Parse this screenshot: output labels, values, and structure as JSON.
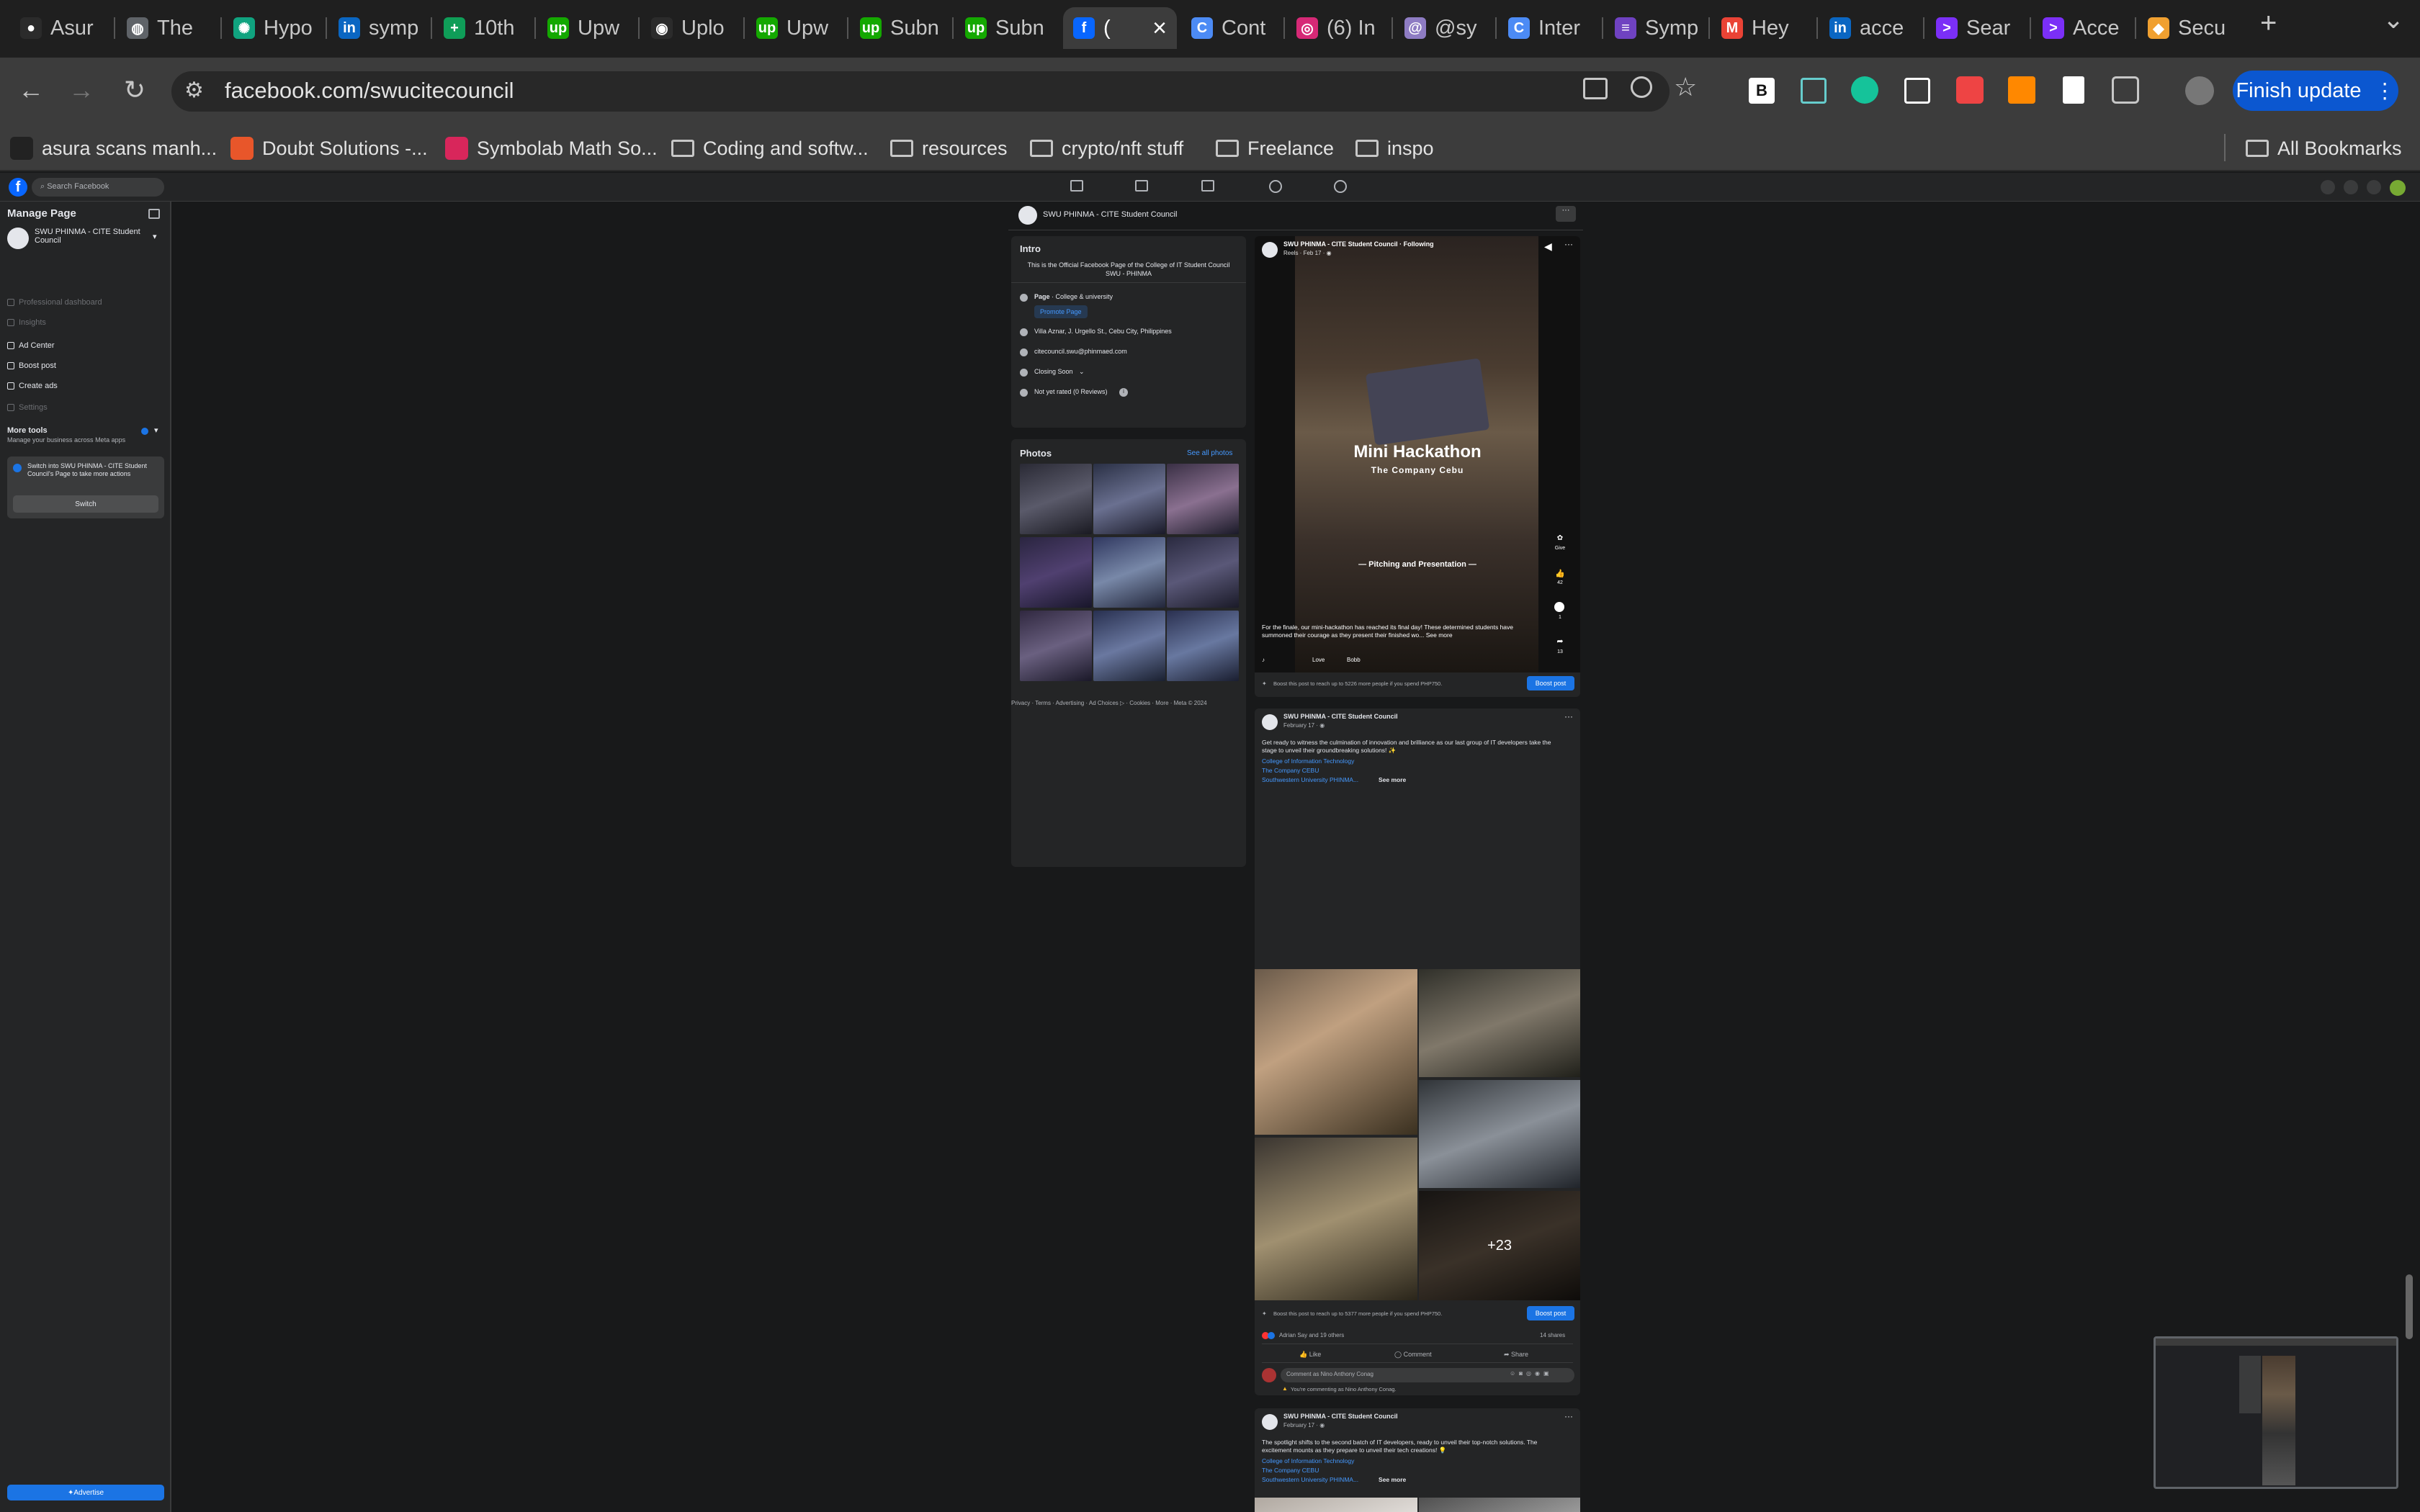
{
  "tabs": [
    {
      "label": "Asur",
      "fav_color": "#2b2b2b",
      "fav_glyph": "●"
    },
    {
      "label": "The",
      "fav_color": "#5f6368",
      "fav_glyph": "◍"
    },
    {
      "label": "Hypo",
      "fav_color": "#10a37f",
      "fav_glyph": "✺"
    },
    {
      "label": "symp",
      "fav_color": "#0a66c2",
      "fav_glyph": "in"
    },
    {
      "label": "10th",
      "fav_color": "#0f9d58",
      "fav_glyph": "+"
    },
    {
      "label": "Upw",
      "fav_color": "#14a800",
      "fav_glyph": "up"
    },
    {
      "label": "Uplo",
      "fav_color": "#2b2b2b",
      "fav_glyph": "◉"
    },
    {
      "label": "Upw",
      "fav_color": "#14a800",
      "fav_glyph": "up"
    },
    {
      "label": "Subn",
      "fav_color": "#14a800",
      "fav_glyph": "up"
    },
    {
      "label": "Subn",
      "fav_color": "#14a800",
      "fav_glyph": "up"
    },
    {
      "label": "(",
      "fav_color": "#0866ff",
      "fav_glyph": "f"
    },
    {
      "label": "Cont",
      "fav_color": "#4c8bf5",
      "fav_glyph": "C"
    },
    {
      "label": "(6) In",
      "fav_color": "#d62976",
      "fav_glyph": "◎"
    },
    {
      "label": "@sy",
      "fav_color": "#8e7cc3",
      "fav_glyph": "@"
    },
    {
      "label": "Inter",
      "fav_color": "#4c8bf5",
      "fav_glyph": "C"
    },
    {
      "label": "Symp",
      "fav_color": "#6f42c1",
      "fav_glyph": "≡"
    },
    {
      "label": "Hey",
      "fav_color": "#ea4335",
      "fav_glyph": "M"
    },
    {
      "label": "acce",
      "fav_color": "#0a66c2",
      "fav_glyph": "in"
    },
    {
      "label": "Sear",
      "fav_color": "#7b2ff7",
      "fav_glyph": ">"
    },
    {
      "label": "Acce",
      "fav_color": "#7b2ff7",
      "fav_glyph": ">"
    },
    {
      "label": "Secu",
      "fav_color": "#f0a030",
      "fav_glyph": "◆"
    }
  ],
  "active_tab_close": "×",
  "new_tab": "+",
  "tab_menu": "⌄",
  "nav": {
    "back": "←",
    "forward": "→",
    "reload": "↻",
    "site_info": "⚙"
  },
  "url": "facebook.com/swucitecouncil",
  "finish_update": "Finish update",
  "more_menu": "⋮",
  "bookmarks": [
    {
      "label": "asura scans manh...",
      "type": "site",
      "color": "#222"
    },
    {
      "label": "Doubt Solutions -...",
      "type": "site",
      "color": "#e8562a"
    },
    {
      "label": "Symbolab Math So...",
      "type": "site",
      "color": "#d8265b"
    },
    {
      "label": "Coding and softw...",
      "type": "folder"
    },
    {
      "label": "resources",
      "type": "folder"
    },
    {
      "label": "crypto/nft stuff",
      "type": "folder"
    },
    {
      "label": "Freelance",
      "type": "folder"
    },
    {
      "label": "inspo",
      "type": "folder"
    }
  ],
  "all_bookmarks": "All Bookmarks",
  "fb": {
    "search_placeholder": "Search Facebook",
    "manage_page": "Manage Page",
    "page_name": "SWU PHINMA - CITE Student Council",
    "side_items": [
      {
        "label": "Professional dashboard",
        "dim": true
      },
      {
        "label": "Insights",
        "dim": true
      },
      {
        "label": "Ad Center",
        "dim": false
      },
      {
        "label": "Boost post",
        "dim": false
      },
      {
        "label": "Create ads",
        "dim": false
      },
      {
        "label": "Settings",
        "dim": true
      }
    ],
    "more_tools": "More tools",
    "more_tools_sub": "Manage your business across Meta apps",
    "switch_text": "Switch into SWU PHINMA - CITE Student Council's Page to take more actions",
    "switch_btn": "Switch",
    "advertise": "Advertise",
    "header_page_name": "SWU PHINMA - CITE Student Council",
    "intro": {
      "title": "Intro",
      "bio": "This is the Official Facebook Page of the College of IT Student Council SWU - PHINMA",
      "category_label": "Page",
      "category": " · College & university",
      "promote": "Promote Page",
      "address": "Villa Aznar, J. Urgello St., Cebu City, Philippines",
      "email": "citecouncil.swu@phinmaed.com",
      "hours": "Closing Soon",
      "rating": "Not yet rated (0 Reviews)"
    },
    "photos": {
      "title": "Photos",
      "see_all": "See all photos"
    },
    "footer": "Privacy · Terms · Advertising · Ad Choices ▷ · Cookies · More · Meta © 2024",
    "post1": {
      "author": "SWU PHINMA - CITE Student Council · Following",
      "meta": "Reels · Feb 17 · ◉",
      "title": "Mini Hackathon",
      "subtitle": "The Company Cebu",
      "segment": "— Pitching and Presentation —",
      "caption": "For the finale, our mini-hackathon has reached its final day! These determined students have summoned their courage as they present their finished wo... See more",
      "audio": "Love",
      "audio_artist": "Bobb",
      "counts": {
        "give": "Give",
        "likes": "42",
        "comments": "1",
        "shares": "13"
      },
      "boost_text": "Boost this post to reach up to 5226 more people if you spend PHP750.",
      "boost_btn": "Boost post"
    },
    "post2": {
      "author": "SWU PHINMA - CITE Student Council",
      "meta": "February 17 · ◉",
      "text": "Get ready to witness the culmination of innovation and brilliance as our last group of IT developers take the stage to unveil their groundbreaking solutions! ✨",
      "tags": [
        "College of Information Technology",
        "The Company CEBU",
        "Southwestern University PHINMA..."
      ],
      "see_more": "See more",
      "more_count": "+23",
      "boost_text": "Boost this post to reach up to 5377 more people if you spend PHP750.",
      "boost_btn": "Boost post",
      "reactions": "Adrian Say and 19 others",
      "shares": "14 shares",
      "like": "Like",
      "comment": "Comment",
      "share": "Share",
      "comment_placeholder": "Comment as Nino Anthony Conag",
      "commenting_as": "You're commenting as Nino Anthony Conag."
    },
    "post3": {
      "author": "SWU PHINMA - CITE Student Council",
      "meta": "February 17 · ◉",
      "text": "The spotlight shifts to the second batch of IT developers, ready to unveil their top-notch solutions. The excitement mounts as they prepare to unveil their tech creations! 💡",
      "tags": [
        "College of Information Technology",
        "The Company CEBU",
        "Southwestern University PHINMA..."
      ],
      "see_more": "See more"
    }
  }
}
